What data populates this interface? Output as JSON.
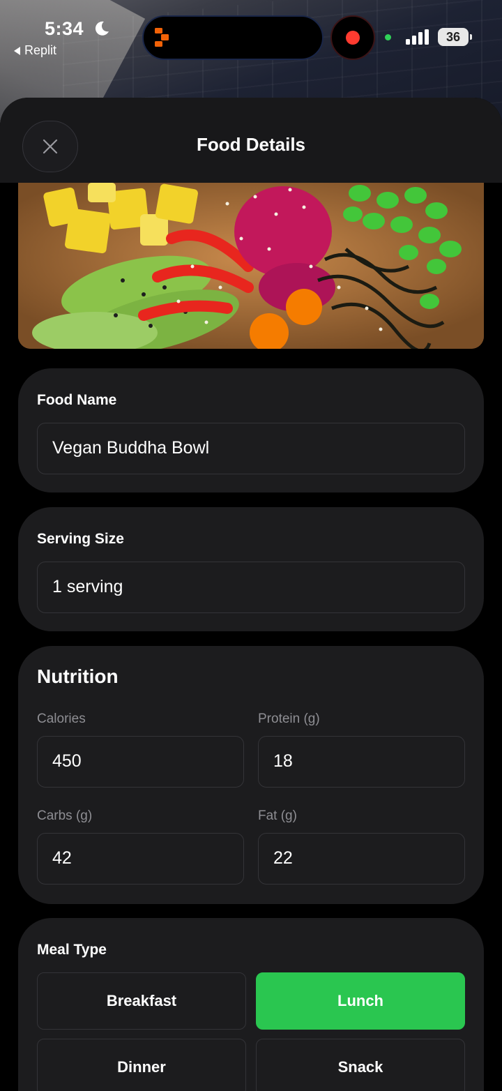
{
  "status_bar": {
    "time": "5:34",
    "back_app": "Replit",
    "battery": "36",
    "recording_color": "#ff3b30",
    "camera_indicator_color": "#30d158"
  },
  "header": {
    "title": "Food Details",
    "close_icon": "close-icon"
  },
  "food_name": {
    "label": "Food Name",
    "value": "Vegan Buddha Bowl"
  },
  "serving_size": {
    "label": "Serving Size",
    "value": "1 serving"
  },
  "nutrition": {
    "title": "Nutrition",
    "calories_label": "Calories",
    "calories_value": "450",
    "protein_label": "Protein (g)",
    "protein_value": "18",
    "carbs_label": "Carbs (g)",
    "carbs_value": "42",
    "fat_label": "Fat (g)",
    "fat_value": "22"
  },
  "meal_type": {
    "label": "Meal Type",
    "options": [
      "Breakfast",
      "Lunch",
      "Dinner",
      "Snack"
    ],
    "selected": "Lunch",
    "accent_color": "#2ac650"
  }
}
